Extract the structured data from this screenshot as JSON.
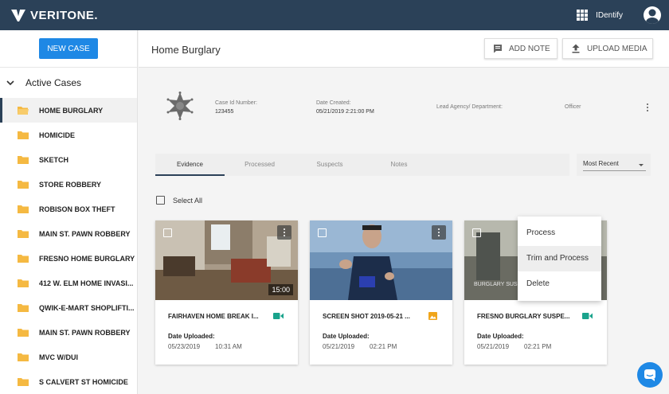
{
  "app": {
    "brand": "VERITONE.",
    "app_name": "IDentify"
  },
  "colors": {
    "topbar": "#2b4158",
    "primary": "#1e88e5",
    "folder": "#f5b942",
    "video_icon": "#1aa38c",
    "image_icon": "#f0a51b"
  },
  "sidebar": {
    "new_case_label": "NEW CASE",
    "section_label": "Active Cases",
    "cases": [
      {
        "label": "HOME BURGLARY",
        "selected": true
      },
      {
        "label": "HOMICIDE"
      },
      {
        "label": "SKETCH"
      },
      {
        "label": "STORE ROBBERY"
      },
      {
        "label": "ROBISON BOX THEFT"
      },
      {
        "label": "MAIN ST. PAWN ROBBERY"
      },
      {
        "label": "FRESNO HOME BURGLARY"
      },
      {
        "label": "412 W. ELM HOME INVASI..."
      },
      {
        "label": "QWIK-E-MART SHOPLIFTI..."
      },
      {
        "label": "MAIN ST. PAWN ROBBERY"
      },
      {
        "label": "MVC W/DUI"
      },
      {
        "label": "S CALVERT ST HOMICIDE"
      }
    ]
  },
  "header": {
    "title": "Home Burglary",
    "add_note_label": "ADD NOTE",
    "upload_media_label": "UPLOAD MEDIA"
  },
  "case_info": {
    "case_id_label": "Case Id Number:",
    "case_id_value": "123455",
    "date_created_label": "Date Created:",
    "date_created_value": "05/21/2019 2:21:00 PM",
    "lead_agency_label": "Lead Agency/ Department:",
    "officer_label": "Officer"
  },
  "tabs": [
    {
      "label": "Evidence",
      "active": true
    },
    {
      "label": "Processed"
    },
    {
      "label": "Suspects"
    },
    {
      "label": "Notes"
    }
  ],
  "sort": {
    "selected": "Most Recent"
  },
  "select_all_label": "Select All",
  "cards": [
    {
      "name": "FAIRHAVEN HOME BREAK I...",
      "media_type": "video-icon",
      "date_label": "Date Uploaded:",
      "date": "05/23/2019",
      "time": "10:31 AM",
      "duration": "15:00"
    },
    {
      "name": "SCREEN SHOT 2019-05-21 ...",
      "media_type": "image-icon",
      "date_label": "Date Uploaded:",
      "date": "05/21/2019",
      "time": "02:21 PM"
    },
    {
      "name": "FRESNO BURGLARY SUSPE...",
      "media_type": "video-icon",
      "date_label": "Date Uploaded:",
      "date": "05/21/2019",
      "time": "02:21 PM",
      "overlay_text": "BURGLARY SUSP"
    }
  ],
  "context_menu": {
    "items": [
      "Process",
      "Trim and Process",
      "Delete"
    ],
    "hovered": "Trim and Process"
  }
}
